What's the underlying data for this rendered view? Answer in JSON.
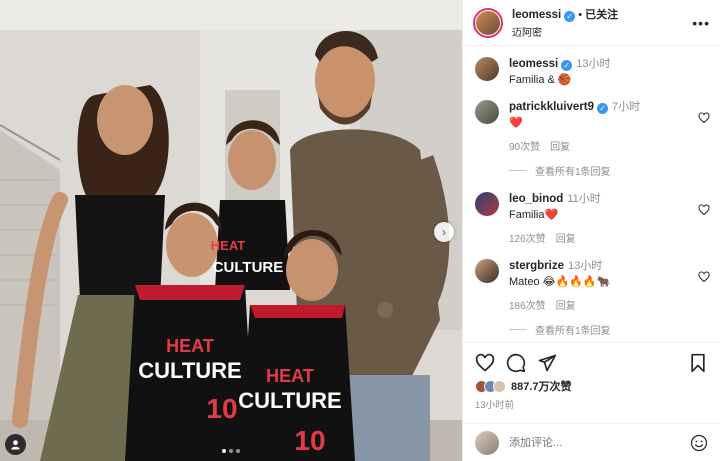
{
  "post": {
    "author": "leomessi",
    "location": "迈阿密",
    "follow_state": "已关注",
    "separator": "•",
    "more_icon": "more-horizontal-icon",
    "caption_author": "leomessi",
    "caption_time": "13小时",
    "caption_text": "Familia & 🏀",
    "likes": "887.7万次赞",
    "time_ago": "13小时前",
    "add_comment_placeholder": "添加评论...",
    "carousel_dots": 3,
    "photo_jersey_text": [
      "HEAT",
      "CULTURE",
      "10"
    ]
  },
  "comments": [
    {
      "user": "patrickkluivert9",
      "verified": true,
      "time": "7小时",
      "text": "❤️",
      "likes": "90次赞",
      "reply": "回复",
      "view_replies": "查看所有1条回复"
    },
    {
      "user": "leo_binod",
      "verified": false,
      "time": "11小时",
      "text": "Familia❤️",
      "likes": "126次赞",
      "reply": "回复",
      "view_replies": ""
    },
    {
      "user": "stergbrize",
      "verified": false,
      "time": "13小时",
      "text": "Mateo 😂🔥🔥🔥🐂",
      "likes": "186次赞",
      "reply": "回复",
      "view_replies": "查看所有1条回复"
    }
  ],
  "colors": {
    "verified": "#3897f0",
    "story_ring": "#e1306c",
    "muted": "#8e8e8e",
    "text": "#262626"
  }
}
